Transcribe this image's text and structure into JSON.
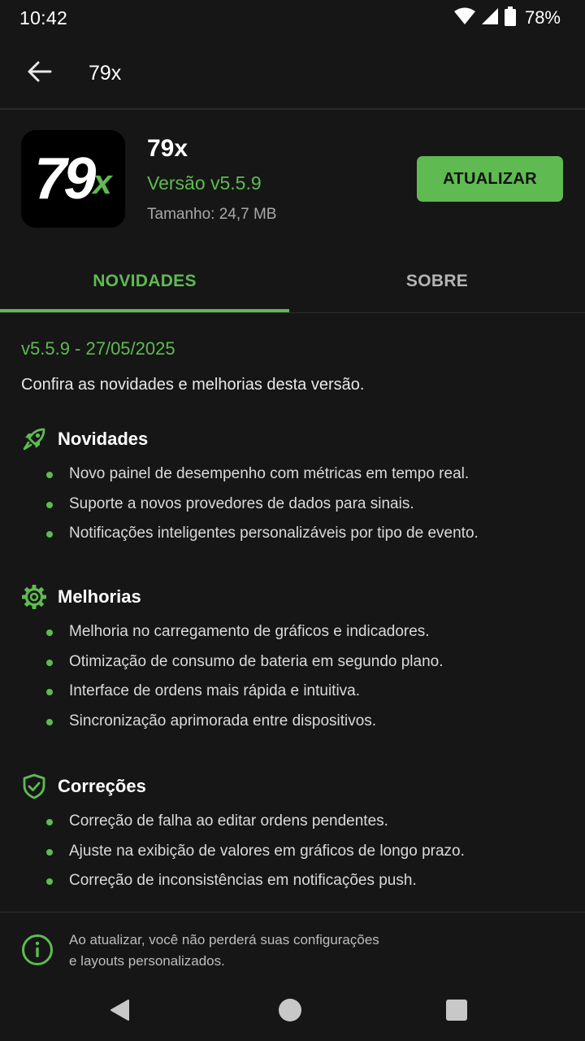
{
  "status_bar": {
    "time": "10:42",
    "battery": "78%",
    "icons": [
      "wifi-icon",
      "signal-icon",
      "battery-icon"
    ]
  },
  "app_bar": {
    "back_icon": "arrow-left-icon",
    "title": "79x"
  },
  "app": {
    "logo_text": "79",
    "logo_accent": "x",
    "name": "79x",
    "version": "Versão v5.5.9",
    "size": "Tamanho: 24,7 MB",
    "update_label": "ATUALIZAR"
  },
  "tabs": [
    {
      "label": "NOVIDADES",
      "active": true
    },
    {
      "label": "SOBRE",
      "active": false
    }
  ],
  "release": {
    "heading": "v5.5.9 - 27/05/2025",
    "intro": "Confira as novidades e melhorias desta versão.",
    "sections": [
      {
        "title": "Novidades",
        "icon": "rocket-icon",
        "items": [
          "Novo painel de desempenho com métricas em tempo real.",
          "Suporte a novos provedores de dados para sinais.",
          "Notificações inteligentes personalizáveis por tipo de evento."
        ]
      },
      {
        "title": "Melhorias",
        "icon": "gear-icon",
        "items": [
          "Melhoria no carregamento de gráficos e indicadores.",
          "Otimização de consumo de bateria em segundo plano.",
          "Interface de ordens mais rápida e intuitiva.",
          "Sincronização aprimorada entre dispositivos."
        ]
      },
      {
        "title": "Correções",
        "icon": "shield-check-icon",
        "items": [
          "Correção de falha ao editar ordens pendentes.",
          "Ajuste na exibição de valores em gráficos de longo prazo.",
          "Correção de inconsistências em notificações push."
        ]
      }
    ]
  },
  "footer": {
    "icon": "info-icon",
    "line1": "Ao atualizar, você não perderá suas configurações",
    "line2": "e layouts personalizados."
  },
  "nav_bar": {
    "icons": [
      "back-triangle-icon",
      "home-circle-icon",
      "recents-square-icon"
    ]
  },
  "colors": {
    "background": "#161616",
    "accent": "#5fba52",
    "text": "#ececec",
    "muted": "#a8a8a8"
  }
}
